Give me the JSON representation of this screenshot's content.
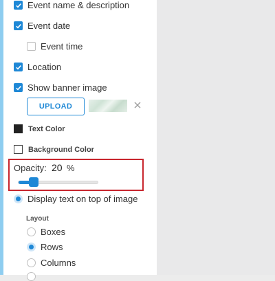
{
  "options": [
    {
      "label": "Event name & description",
      "checked": true
    },
    {
      "label": "Event date",
      "checked": true
    },
    {
      "label": "Event time",
      "checked": false
    },
    {
      "label": "Location",
      "checked": true
    },
    {
      "label": "Show banner image",
      "checked": true
    }
  ],
  "upload": {
    "button_label": "UPLOAD",
    "remove_icon": "close-icon"
  },
  "colors": {
    "text_color_label": "Text Color",
    "text_color_value": "#222222",
    "background_color_label": "Background Color",
    "background_color_value": "#ffffff"
  },
  "opacity": {
    "label": "Opacity:",
    "value": "20",
    "unit": "%",
    "slider_fraction": 0.2
  },
  "display": {
    "label": "Display text on top of image",
    "selected": true
  },
  "layout": {
    "label": "Layout",
    "options": [
      {
        "label": "Boxes",
        "selected": false
      },
      {
        "label": "Rows",
        "selected": true
      },
      {
        "label": "Columns",
        "selected": false
      }
    ]
  },
  "accent_color": "#1e88d6"
}
